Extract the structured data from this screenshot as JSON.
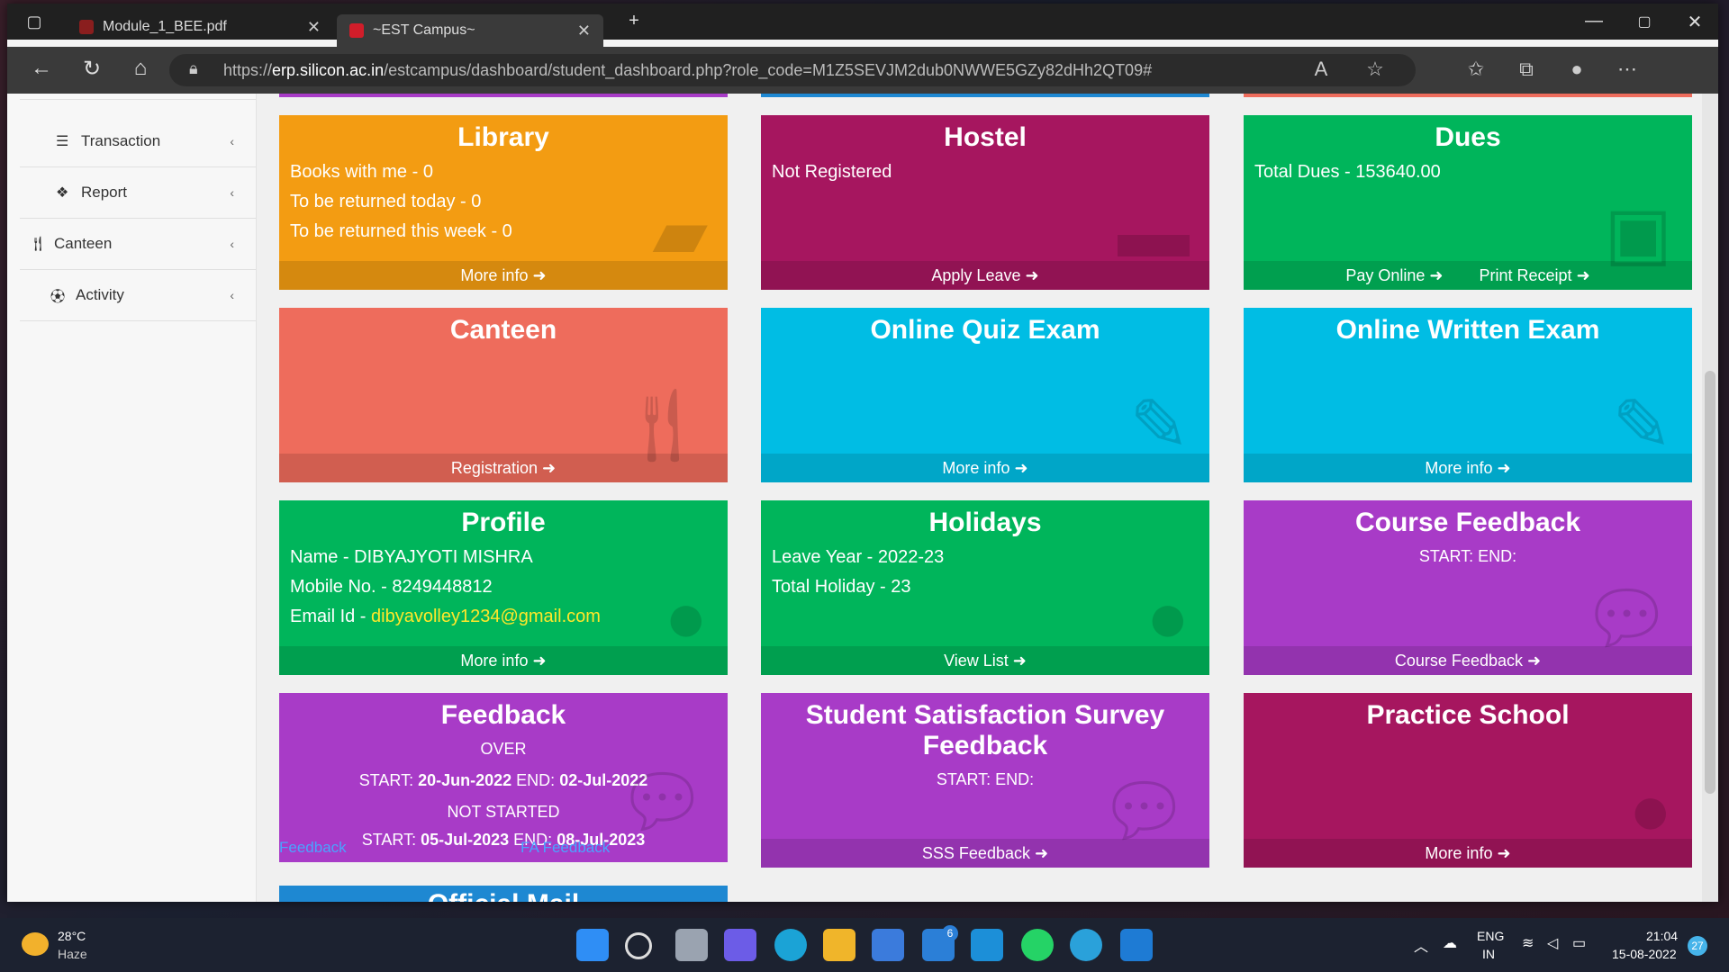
{
  "browser": {
    "tabs": [
      {
        "title": "Module_1_BEE.pdf"
      },
      {
        "title": "~EST Campus~"
      }
    ],
    "url_prefix": "https://",
    "url_host": "erp.silicon.ac.in",
    "url_path": "/estcampus/dashboard/student_dashboard.php?role_code=M1Z5SEVJM2dub0NWWE5GZy82dHh2QT09#"
  },
  "sidebar": {
    "items": [
      {
        "label": "Transaction"
      },
      {
        "label": "Report"
      },
      {
        "label": "Canteen"
      },
      {
        "label": "Activity"
      }
    ]
  },
  "cards": {
    "library": {
      "title": "Library",
      "line1": "Books with me - 0",
      "line2": "To be returned today - 0",
      "line3": "To be returned this week - 0",
      "footer": "More info"
    },
    "hostel": {
      "title": "Hostel",
      "line1": "Not Registered",
      "footer": "Apply Leave"
    },
    "dues": {
      "title": "Dues",
      "line1": "Total Dues - 153640.00",
      "footer1": "Pay Online",
      "footer2": "Print Receipt"
    },
    "canteen": {
      "title": "Canteen",
      "footer": "Registration"
    },
    "quiz": {
      "title": "Online Quiz Exam",
      "footer": "More info"
    },
    "written": {
      "title": "Online Written Exam",
      "footer": "More info"
    },
    "profile": {
      "title": "Profile",
      "name": "Name - DIBYAJYOTI MISHRA",
      "mobile": "Mobile No. - 8249448812",
      "email_label": "Email Id - ",
      "email": "dibyavolley1234@gmail.com",
      "footer": "More info"
    },
    "holidays": {
      "title": "Holidays",
      "line1": "Leave Year - 2022-23",
      "line2": "Total Holiday - 23",
      "footer": "View List"
    },
    "course_feedback": {
      "title": "Course Feedback",
      "line1": "START: END:",
      "footer": "Course Feedback"
    },
    "feedback": {
      "title": "Feedback",
      "line1": "OVER",
      "line2_label": "START: ",
      "line2_start": "20-Jun-2022",
      "line2_mid": " END: ",
      "line2_end": "02-Jul-2022",
      "line3": "NOT STARTED",
      "line4_label": "START: ",
      "line4_start": "05-Jul-2023",
      "line4_mid": " END: ",
      "line4_end": "08-Jul-2023",
      "link1": "Feedback",
      "link2": "FA Feedback"
    },
    "sss": {
      "title": "Student Satisfaction Survey Feedback",
      "line1": "START: END:",
      "footer": "SSS Feedback"
    },
    "practice": {
      "title": "Practice School",
      "footer": "More info"
    },
    "mail": {
      "title": "Official Mail"
    }
  },
  "taskbar": {
    "weather_temp": "28°C",
    "weather_desc": "Haze",
    "lang1": "ENG",
    "lang2": "IN",
    "time": "21:04",
    "date": "15-08-2022",
    "notif_count": "27",
    "mail_badge": "6"
  },
  "colors": {
    "orange": "#f39c12",
    "maroon": "#a6165f",
    "green": "#00b55b",
    "salmon": "#ee6c5c",
    "cyan": "#00bde4",
    "purple": "#a83bc7",
    "blue": "#1e88d2",
    "email_link": "#ffe82a"
  }
}
